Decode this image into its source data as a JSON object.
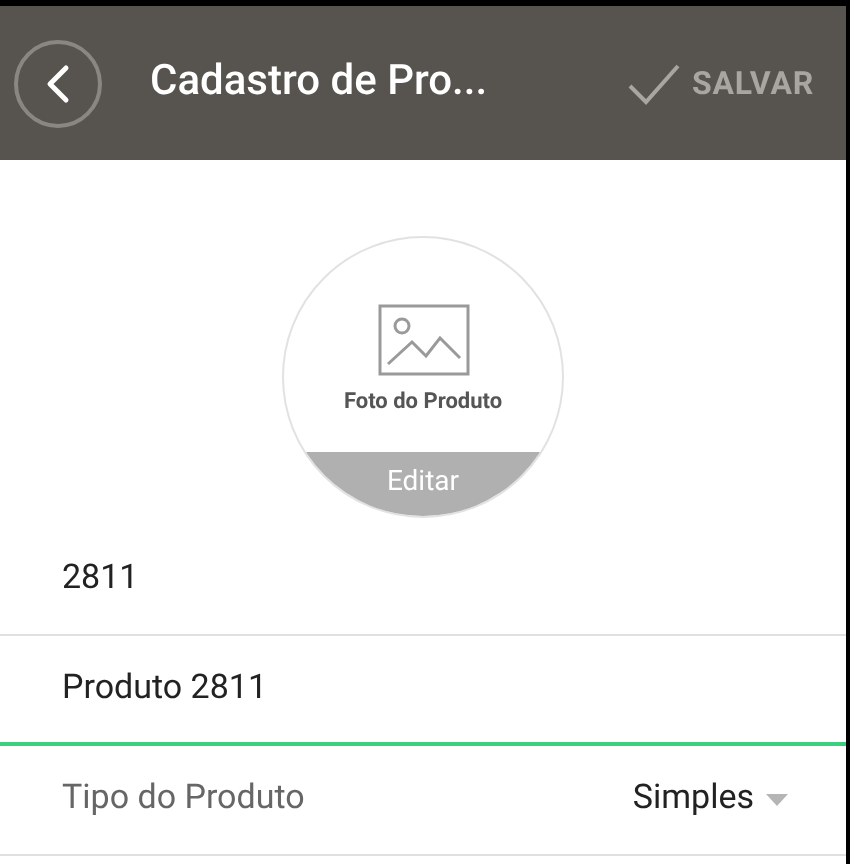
{
  "header": {
    "title": "Cadastro de Pro...",
    "save_label": "SALVAR"
  },
  "photo": {
    "caption": "Foto do Produto",
    "edit_label": "Editar"
  },
  "fields": [
    {
      "kind": "text",
      "value": "2811",
      "focused": false
    },
    {
      "kind": "text",
      "value": "Produto 2811",
      "focused": true
    },
    {
      "kind": "select",
      "label": "Tipo do Produto",
      "value": "Simples",
      "focused": false
    }
  ]
}
